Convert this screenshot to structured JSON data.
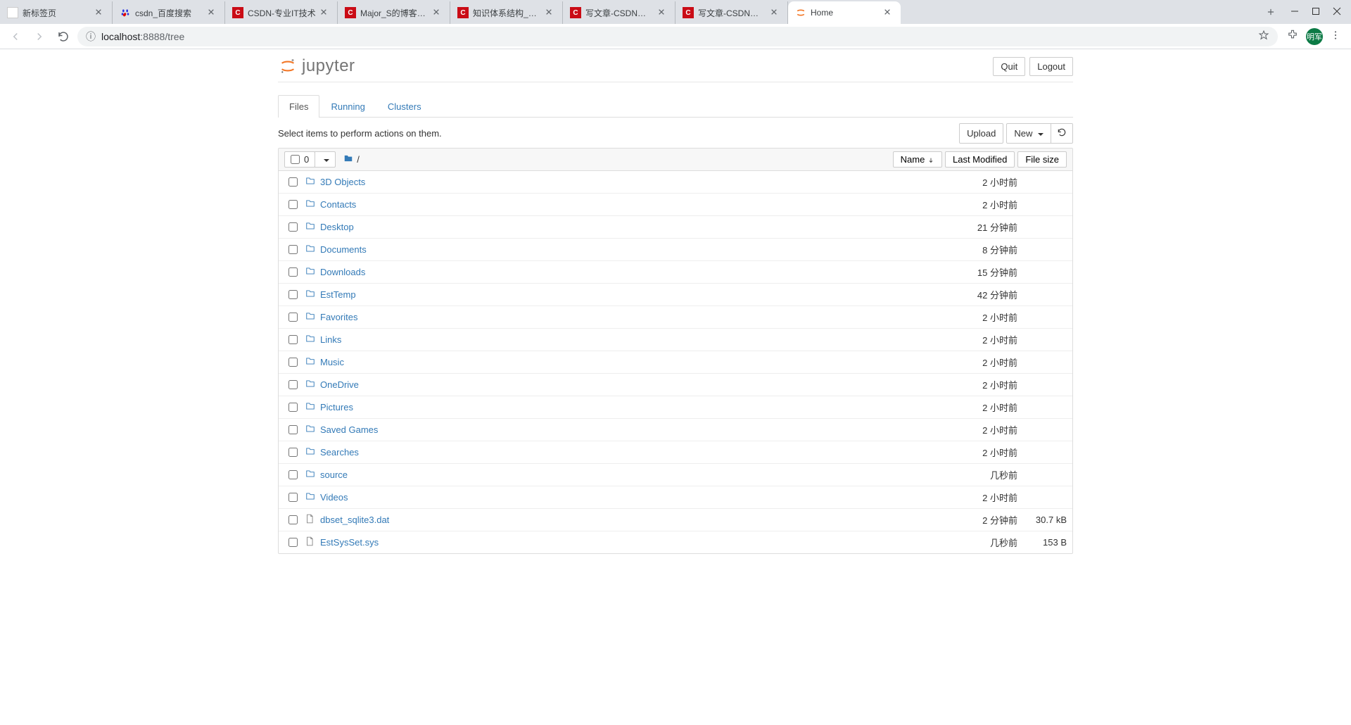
{
  "browser": {
    "tabs": [
      {
        "title": "新标签页",
        "favicon": "generic"
      },
      {
        "title": "csdn_百度搜索",
        "favicon": "baidu"
      },
      {
        "title": "CSDN-专业IT技术",
        "favicon": "csdn"
      },
      {
        "title": "Major_S的博客_M",
        "favicon": "csdn"
      },
      {
        "title": "知识体系结构_Maj",
        "favicon": "csdn"
      },
      {
        "title": "写文章-CSDN博客",
        "favicon": "csdn"
      },
      {
        "title": "写文章-CSDN博客",
        "favicon": "csdn"
      },
      {
        "title": "Home",
        "favicon": "jupyter",
        "active": true
      }
    ],
    "url_proto": "ⓘ",
    "url_host": "localhost",
    "url_port": ":8888",
    "url_path": "/tree",
    "avatar_text": "明军"
  },
  "header": {
    "logo_text": "jupyter",
    "quit": "Quit",
    "logout": "Logout"
  },
  "nav_tabs": {
    "files": "Files",
    "running": "Running",
    "clusters": "Clusters"
  },
  "toolbar": {
    "hint": "Select items to perform actions on them.",
    "upload": "Upload",
    "new": "New",
    "select_count": "0",
    "breadcrumb_sep": "/"
  },
  "columns": {
    "name": "Name",
    "last_modified": "Last Modified",
    "file_size": "File size"
  },
  "items": [
    {
      "type": "dir",
      "name": "3D Objects",
      "modified": "2 小时前",
      "size": ""
    },
    {
      "type": "dir",
      "name": "Contacts",
      "modified": "2 小时前",
      "size": ""
    },
    {
      "type": "dir",
      "name": "Desktop",
      "modified": "21 分钟前",
      "size": ""
    },
    {
      "type": "dir",
      "name": "Documents",
      "modified": "8 分钟前",
      "size": ""
    },
    {
      "type": "dir",
      "name": "Downloads",
      "modified": "15 分钟前",
      "size": ""
    },
    {
      "type": "dir",
      "name": "EstTemp",
      "modified": "42 分钟前",
      "size": ""
    },
    {
      "type": "dir",
      "name": "Favorites",
      "modified": "2 小时前",
      "size": ""
    },
    {
      "type": "dir",
      "name": "Links",
      "modified": "2 小时前",
      "size": ""
    },
    {
      "type": "dir",
      "name": "Music",
      "modified": "2 小时前",
      "size": ""
    },
    {
      "type": "dir",
      "name": "OneDrive",
      "modified": "2 小时前",
      "size": ""
    },
    {
      "type": "dir",
      "name": "Pictures",
      "modified": "2 小时前",
      "size": ""
    },
    {
      "type": "dir",
      "name": "Saved Games",
      "modified": "2 小时前",
      "size": ""
    },
    {
      "type": "dir",
      "name": "Searches",
      "modified": "2 小时前",
      "size": ""
    },
    {
      "type": "dir",
      "name": "source",
      "modified": "几秒前",
      "size": ""
    },
    {
      "type": "dir",
      "name": "Videos",
      "modified": "2 小时前",
      "size": ""
    },
    {
      "type": "file",
      "name": "dbset_sqlite3.dat",
      "modified": "2 分钟前",
      "size": "30.7 kB"
    },
    {
      "type": "file",
      "name": "EstSysSet.sys",
      "modified": "几秒前",
      "size": "153 B"
    }
  ]
}
